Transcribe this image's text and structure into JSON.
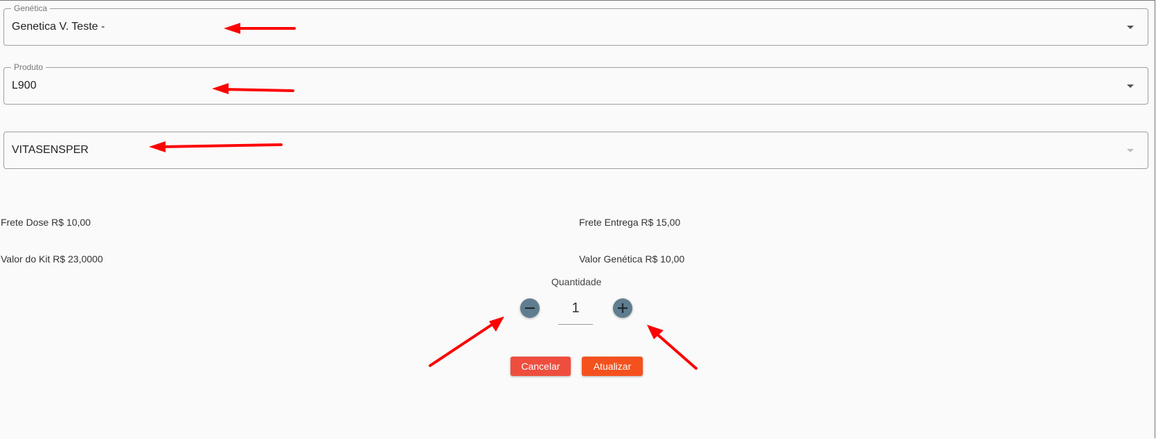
{
  "fields": {
    "genetica": {
      "label": "Genética",
      "value": "Genetica V. Teste -"
    },
    "produto": {
      "label": "Produto",
      "value": "L900"
    },
    "terceiro": {
      "value": "VITASENSPER"
    }
  },
  "info": {
    "frete_dose": "Frete Dose R$ 10,00",
    "frete_entrega": "Frete Entrega R$ 15,00",
    "valor_kit": "Valor do Kit R$ 23,0000",
    "valor_genetica": "Valor Genética R$ 10,00"
  },
  "quantity": {
    "label": "Quantidade",
    "value": "1"
  },
  "buttons": {
    "cancel": "Cancelar",
    "update": "Atualizar"
  },
  "colors": {
    "annotation_arrow": "#ff0000",
    "cancel_button": "#ef4d3d",
    "update_button": "#f4511e",
    "round_button": "#5f7d8e"
  }
}
